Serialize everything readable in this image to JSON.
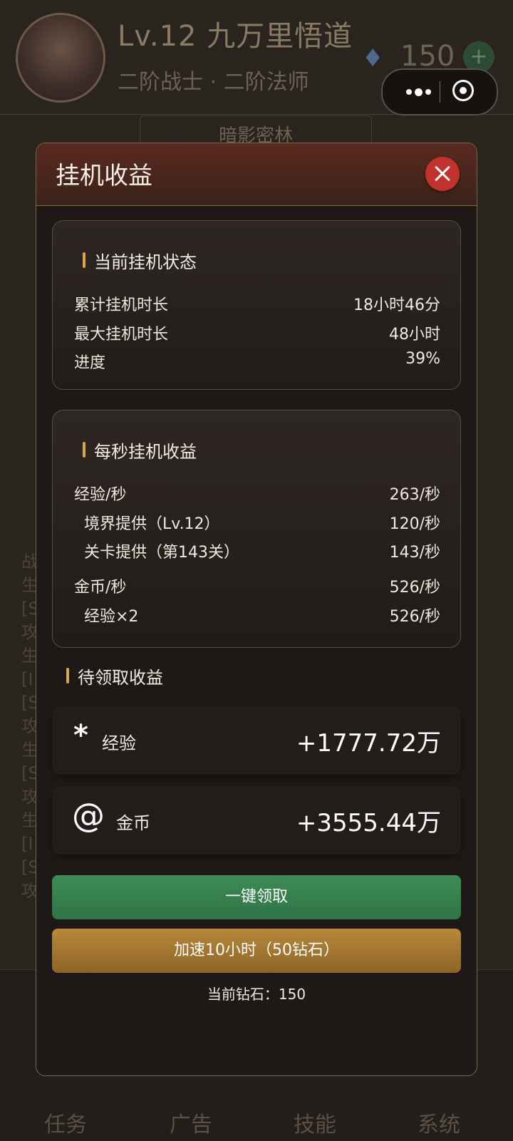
{
  "background": {
    "level_title": "Lv.12 九万里悟道",
    "class_line": "二阶战士 · 二阶法师",
    "gems": "150",
    "plus_label": "+",
    "tab_label": "暗影密林",
    "log_chars": [
      "战",
      "生",
      "[S",
      "攻",
      "生",
      "[I",
      "[S",
      "攻",
      "生",
      "[S",
      "攻",
      "生",
      "[I",
      "[S",
      "攻"
    ],
    "nav": [
      "任务",
      "广告",
      "技能",
      "系统"
    ]
  },
  "modal": {
    "title": "挂机收益",
    "status": {
      "heading": "当前挂机状态",
      "rows": [
        {
          "label": "累计挂机时长",
          "value": "18小时46分"
        },
        {
          "label": "最大挂机时长",
          "value": "48小时"
        },
        {
          "label": "进度",
          "value": "39%"
        }
      ]
    },
    "per_second": {
      "heading": "每秒挂机收益",
      "exp_label": "经验/秒",
      "exp_value": "263/秒",
      "exp_sources": [
        {
          "label": "境界提供（Lv.12）",
          "value": "120/秒"
        },
        {
          "label": "关卡提供（第143关）",
          "value": "143/秒"
        }
      ],
      "gold_label": "金币/秒",
      "gold_value": "526/秒",
      "gold_sources": [
        {
          "label": "经验×2",
          "value": "526/秒"
        }
      ]
    },
    "pending": {
      "heading": "待领取收益",
      "exp": {
        "icon": "*",
        "label": "经验",
        "amount": "+1777.72万"
      },
      "gold": {
        "icon": "@",
        "label": "金币",
        "amount": "+3555.44万"
      }
    },
    "claim_button": "一键领取",
    "boost_button": "加速10小时（50钻石）",
    "current_gems": "当前钻石：150"
  },
  "colors": {
    "accent_gold": "#d9a64a",
    "claim_green": "#3d8b55",
    "boost_gold": "#b8883c",
    "close_red": "#c0322b"
  }
}
